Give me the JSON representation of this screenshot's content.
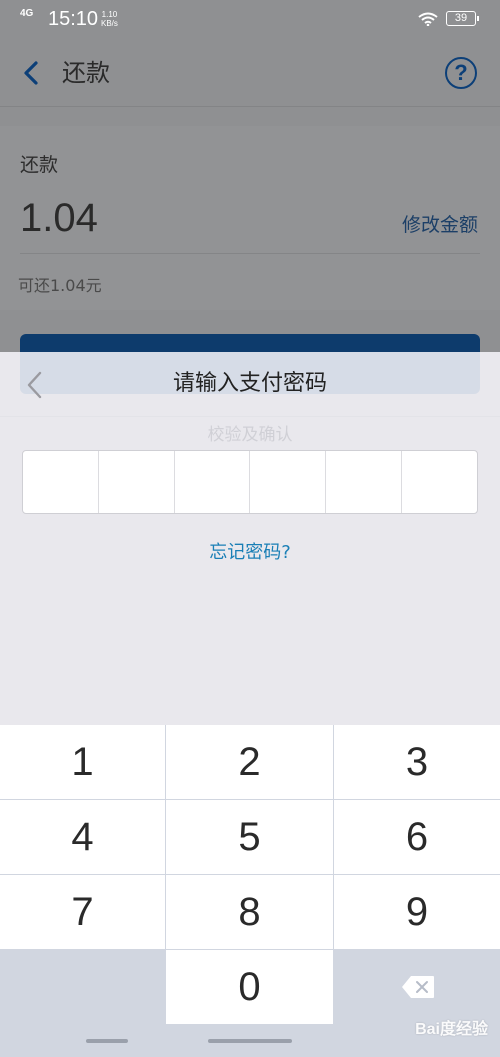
{
  "status_bar": {
    "network": "4G",
    "time": "15:10",
    "speed_value": "1.10",
    "speed_unit": "KB/s",
    "battery": "39"
  },
  "nav": {
    "title": "还款",
    "help_icon": "?"
  },
  "form": {
    "label": "还款",
    "amount": "1.04",
    "edit_label": "修改金额",
    "available": "可还1.04元"
  },
  "background": {
    "agreement_text": "校验及确认"
  },
  "sheet": {
    "title": "请输入支付密码",
    "forgot_label": "忘记密码?"
  },
  "keypad": {
    "keys": [
      "1",
      "2",
      "3",
      "4",
      "5",
      "6",
      "7",
      "8",
      "9",
      "0"
    ]
  },
  "watermark": "Bai度经验",
  "colors": {
    "accent": "#1a7fb6",
    "primary_button": "#0d3b6c",
    "overlay": "#8f9092"
  },
  "icons": {
    "back": "chevron-left-icon",
    "help": "question-circle-icon",
    "delete": "backspace-icon"
  }
}
